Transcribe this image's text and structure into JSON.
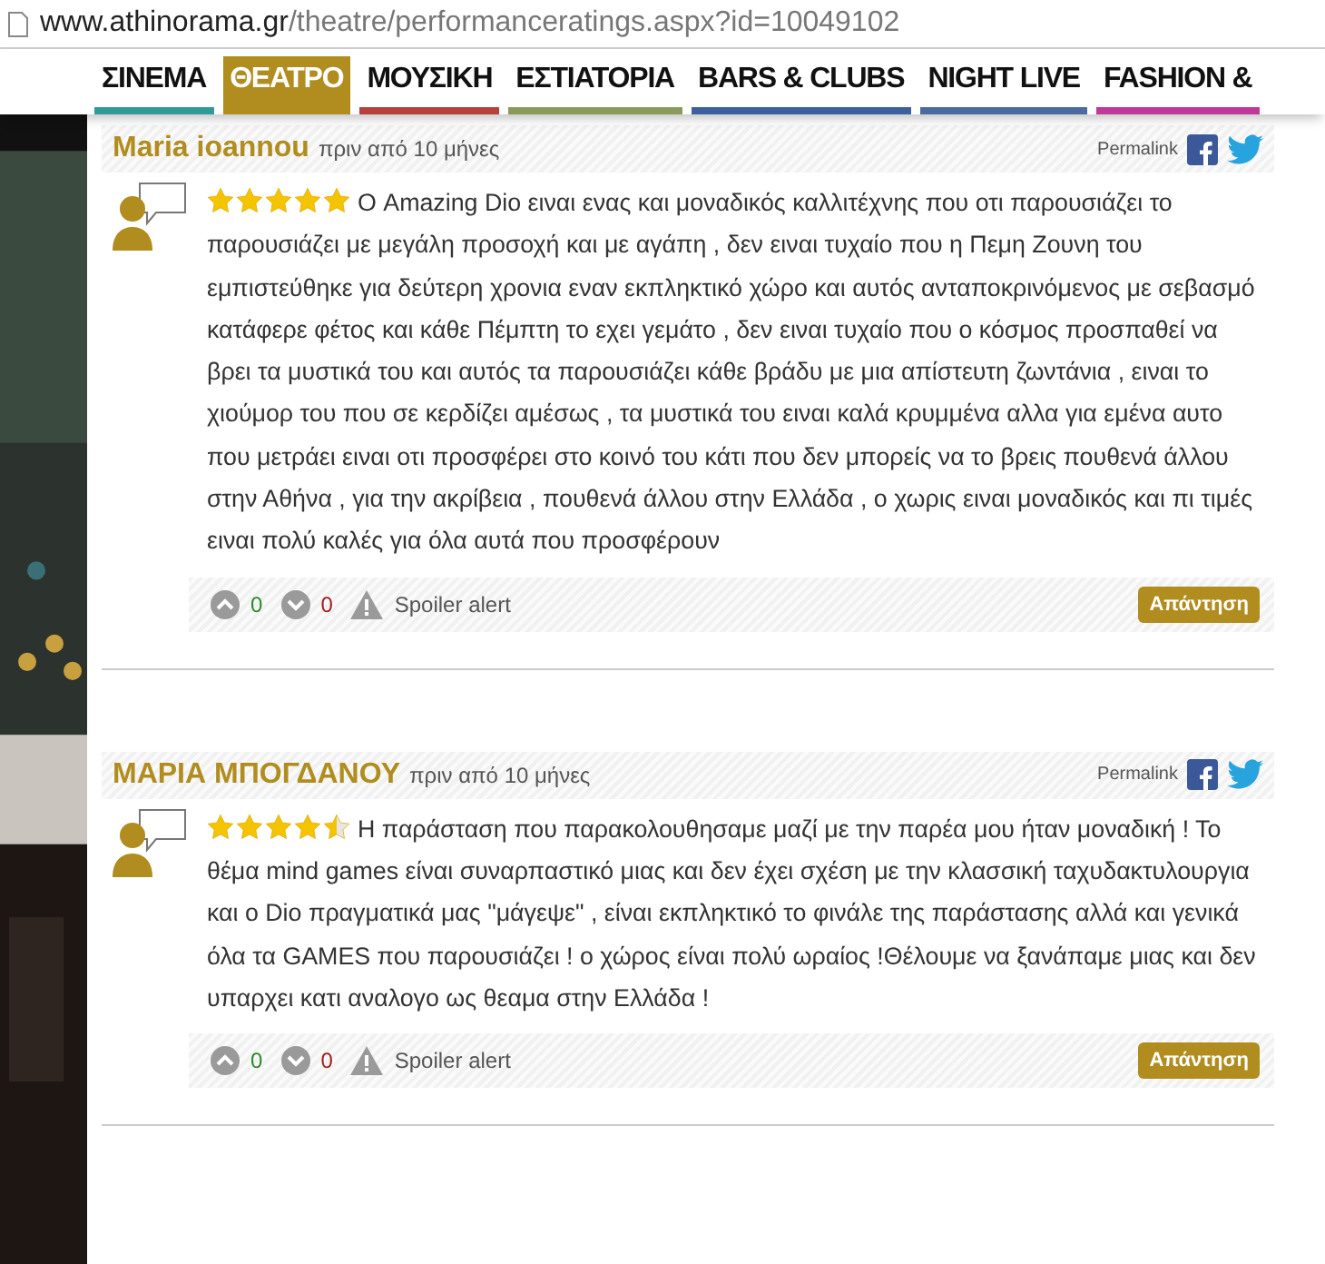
{
  "address_bar": {
    "domain": "www.athinorama.gr",
    "path": "/theatre/performanceratings.aspx?id=10049102"
  },
  "nav": [
    {
      "label": "ΣΙΝΕΜΑ",
      "selected": false,
      "color": "#2f9a98"
    },
    {
      "label": "ΘΕΑΤΡΟ",
      "selected": true,
      "color": "#b08d1e"
    },
    {
      "label": "ΜΟΥΣΙΚΗ",
      "selected": false,
      "color": "#b8403c"
    },
    {
      "label": "ΕΣΤΙΑΤΟΡΙΑ",
      "selected": false,
      "color": "#8a9a5a"
    },
    {
      "label": "BARS & CLUBS",
      "selected": false,
      "color": "#3d5f9e"
    },
    {
      "label": "NIGHT LIVE",
      "selected": false,
      "color": "#4a6aa0"
    },
    {
      "label": "FASHION &",
      "selected": false,
      "color": "#c0399a"
    }
  ],
  "reviews": [
    {
      "author": "Maria ioannou",
      "time": "πριν από 10 μήνες",
      "permalink": "Permalink",
      "stars": 5,
      "text": "Ο Amazing Dio ειναι ενας και μοναδικός καλλιτέχνης που οτι παρουσιάζει το παρουσιάζει με μεγάλη προσοχή και με αγάπη , δεν ειναι τυχαίο που η Πεμη Ζουνη του εμπιστεύθηκε για δεύτερη χρονια εναν εκπληκτικό χώρο και αυτός ανταποκρινόμενος με σεβασμό κατάφερε φέτος και κάθε Πέμπτη το εχει γεμάτο , δεν ειναι τυχαίο που ο κόσμος προσπαθεί να βρει τα μυστικά του και αυτός τα παρουσιάζει κάθε βράδυ με μια απίστευτη ζωντάνια , ειναι το χιούμορ του που σε κερδίζει αμέσως , τα μυστικά του ειναι καλά κρυμμένα αλλα για εμένα αυτο που μετράει ειναι οτι προσφέρει στο κοινό του κάτι που δεν μπορείς να το βρεις πουθενά άλλου στην Αθήνα , για την ακρίβεια , πουθενά άλλου στην Ελλάδα , ο χωρις ειναι μοναδικός και πι τιμές ειναι πολύ καλές για όλα αυτά που προσφέρουν",
      "upvotes": "0",
      "downvotes": "0",
      "spoiler": "Spoiler alert",
      "reply": "Απάντηση"
    },
    {
      "author": "ΜΑΡΙΑ ΜΠΟΓΔΑΝΟΥ",
      "time": "πριν από 10 μήνες",
      "permalink": "Permalink",
      "stars": 4.5,
      "text": "Η παράσταση που παρακολουθησαμε μαζί με την παρέα μου ήταν μοναδική ! Το θέμα mind games είναι συναρπαστικό μιας και δεν έχει σχέση με την κλασσική ταχυδακτυλουργια και ο Dio πραγματικά μας \"μάγεψε\" , είναι εκπληκτικό το φινάλε της παράστασης αλλά και γενικά όλα τα GAMES που παρουσιάζει ! ο χώρος είναι πολύ ωραίος !Θέλουμε να ξανάπαμε μιας και δεν υπαρχει κατι αναλογο ως θεαμα στην Ελλάδα !",
      "upvotes": "0",
      "downvotes": "0",
      "spoiler": "Spoiler alert",
      "reply": "Απάντηση"
    }
  ]
}
